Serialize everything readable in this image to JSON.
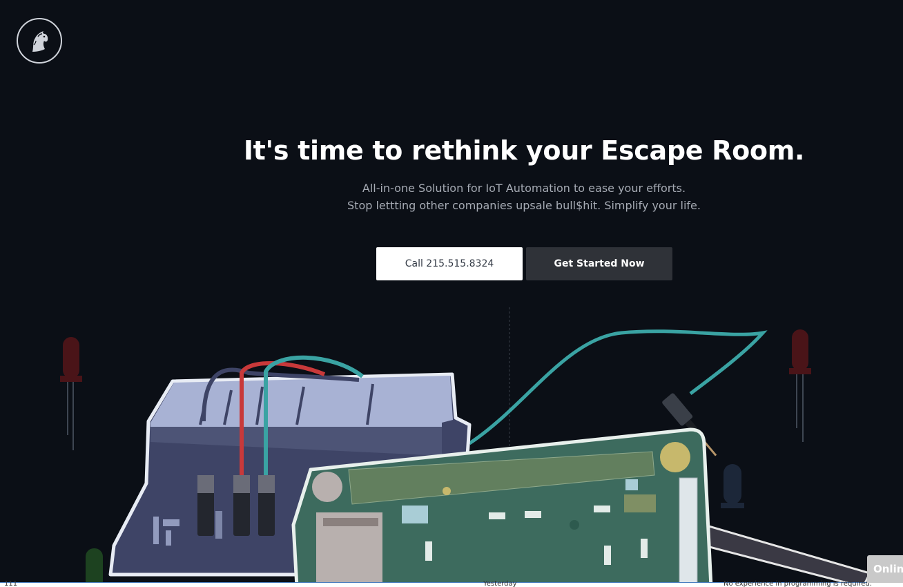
{
  "hero": {
    "title": "It's time to rethink your Escape Room.",
    "subtitle_line1": "All-in-one Solution for IoT Automation to ease your efforts.",
    "subtitle_line2": "Stop lettting other companies upsale bull$hit. Simplify your life."
  },
  "buttons": {
    "call_label": "Call 215.515.8324",
    "start_label": "Get Started Now"
  },
  "chat": {
    "label": "Online"
  },
  "status_strip": {
    "left": "111",
    "middle": "Yesterday",
    "right": "No experience in programming is required."
  },
  "colors": {
    "background": "#0b0f16",
    "call_button": "#ffffff",
    "start_button": "#2f3238",
    "board_green": "#3d6b5e",
    "relay_blue": "#3e4466",
    "wire_teal": "#3aa3a3",
    "wire_red": "#c8393a"
  }
}
